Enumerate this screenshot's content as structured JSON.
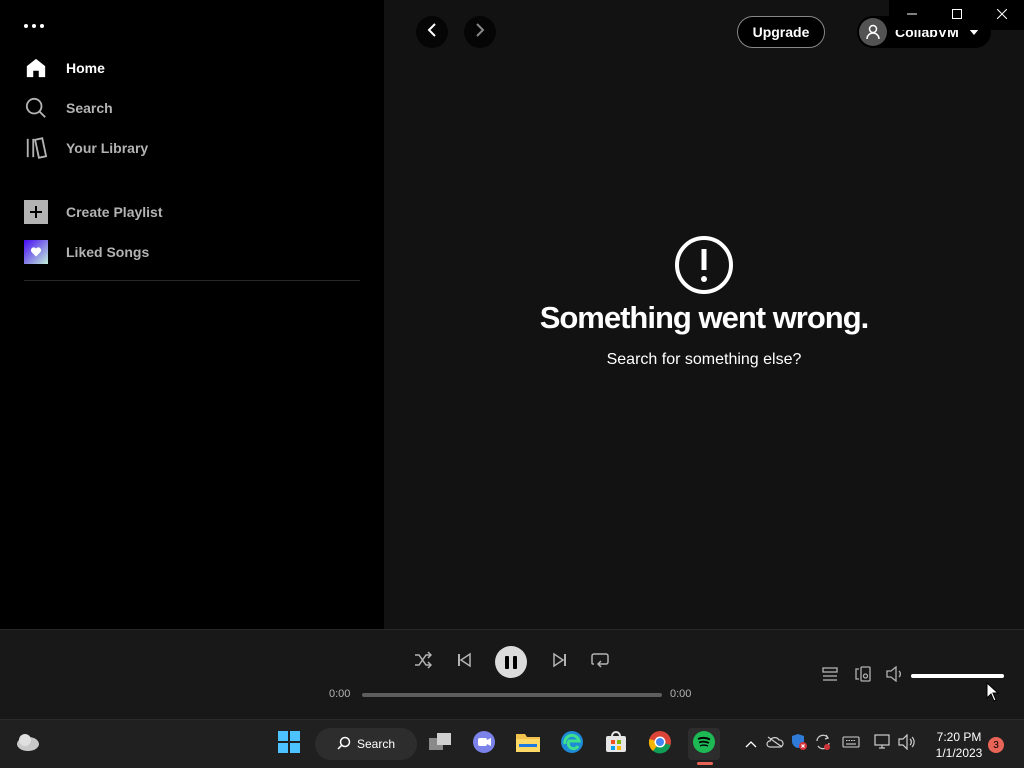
{
  "colors": {
    "accent": "#1db954",
    "main_bg": "#121212",
    "sidebar_bg": "#000000",
    "player_bg": "#181818",
    "taskbar_bg": "#202020",
    "badge": "#e86456"
  },
  "sidebar": {
    "menu_icon": "more-dots-icon",
    "nav": [
      {
        "label": "Home",
        "icon": "home-icon"
      },
      {
        "label": "Search",
        "icon": "search-icon"
      },
      {
        "label": "Your Library",
        "icon": "library-icon"
      }
    ],
    "playlists": [
      {
        "label": "Create Playlist",
        "icon": "plus-icon"
      },
      {
        "label": "Liked Songs",
        "icon": "heart-icon"
      }
    ]
  },
  "header": {
    "back_icon": "chevron-left-icon",
    "forward_icon": "chevron-right-icon",
    "upgrade_label": "Upgrade",
    "user_name": "CollabVM",
    "user_icon": "user-icon"
  },
  "window_controls": [
    "minimize-icon",
    "maximize-icon",
    "close-icon"
  ],
  "error": {
    "icon": "exclamation-circle-icon",
    "title": "Something went wrong.",
    "subtitle": "Search for something else?"
  },
  "player": {
    "controls": [
      "shuffle-icon",
      "previous-icon",
      "pause-icon",
      "next-icon",
      "repeat-icon"
    ],
    "elapsed": "0:00",
    "duration": "0:00",
    "progress": 0,
    "volume": 1.0,
    "right_controls": [
      "queue-icon",
      "connect-device-icon",
      "volume-icon"
    ]
  },
  "taskbar": {
    "search_label": "Search",
    "apps": [
      "weather-icon",
      "windows-start-icon",
      "task-view-icon",
      "teams-chat-icon",
      "file-explorer-icon",
      "edge-icon",
      "microsoft-store-icon",
      "chrome-icon",
      "spotify-icon"
    ],
    "tray": [
      "chevron-up-icon",
      "onedrive-icon",
      "defender-icon",
      "sync-icon",
      "keyboard-icon",
      "network-icon",
      "speaker-icon"
    ],
    "time": "7:20 PM",
    "date": "1/1/2023",
    "notification_count": "3"
  }
}
